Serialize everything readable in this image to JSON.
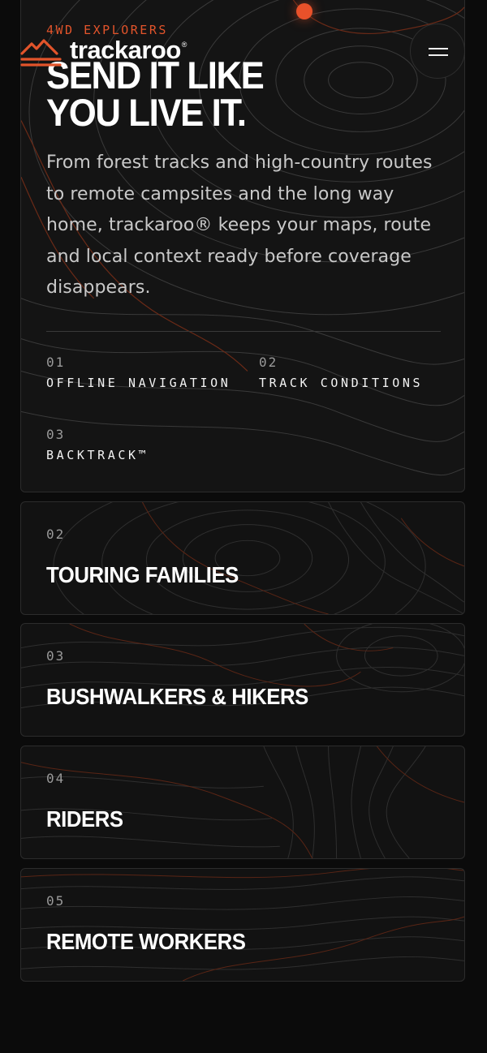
{
  "header": {
    "eyebrow": "4WD EXPLORERS",
    "brand": "trackaroo",
    "brand_mark": "®",
    "menu_icon": "hamburger-icon"
  },
  "hero": {
    "headline_line1": "SEND IT LIKE",
    "headline_line2": "YOU LIVE IT.",
    "intro": "From forest tracks and high-country routes to remote campsites and the long way home, trackaroo® keeps your maps, route and local context ready before coverage disappears.",
    "features": [
      {
        "number": "01",
        "label": "OFFLINE NAVIGATION"
      },
      {
        "number": "02",
        "label": "TRACK CONDITIONS"
      },
      {
        "number": "03",
        "label": "BACKTRACK™"
      }
    ]
  },
  "audiences": [
    {
      "number": "02",
      "title": "TOURING FAMILIES"
    },
    {
      "number": "03",
      "title": "BUSHWALKERS & HIKERS"
    },
    {
      "number": "04",
      "title": "RIDERS"
    },
    {
      "number": "05",
      "title": "REMOTE WORKERS"
    }
  ],
  "colors": {
    "accent": "#e2542b",
    "background": "#0b0b0b",
    "card": "#141414",
    "text": "#ffffff",
    "muted": "#9a9a9a"
  }
}
